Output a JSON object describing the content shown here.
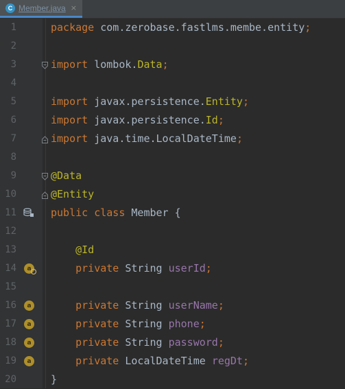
{
  "tab": {
    "icon_letter": "C",
    "title": "Member.java",
    "close_glyph": "×"
  },
  "editor": {
    "lines": [
      {
        "n": "1",
        "tokens": [
          {
            "t": "package ",
            "c": "kw"
          },
          {
            "t": "com.zerobase.fastlms.membe.entity",
            "c": ""
          },
          {
            "t": ";",
            "c": "kw"
          }
        ]
      },
      {
        "n": "2",
        "tokens": []
      },
      {
        "n": "3",
        "fold": "start",
        "tokens": [
          {
            "t": "import ",
            "c": "kw"
          },
          {
            "t": "lombok.",
            "c": ""
          },
          {
            "t": "Data",
            "c": "ann"
          },
          {
            "t": ";",
            "c": "kw"
          }
        ]
      },
      {
        "n": "4",
        "tokens": []
      },
      {
        "n": "5",
        "tokens": [
          {
            "t": "import ",
            "c": "kw"
          },
          {
            "t": "javax.persistence.",
            "c": ""
          },
          {
            "t": "Entity",
            "c": "ann"
          },
          {
            "t": ";",
            "c": "kw"
          }
        ]
      },
      {
        "n": "6",
        "tokens": [
          {
            "t": "import ",
            "c": "kw"
          },
          {
            "t": "javax.persistence.",
            "c": ""
          },
          {
            "t": "Id",
            "c": "ann"
          },
          {
            "t": ";",
            "c": "kw"
          }
        ]
      },
      {
        "n": "7",
        "fold": "end",
        "tokens": [
          {
            "t": "import ",
            "c": "kw"
          },
          {
            "t": "java.time.LocalDateTime",
            "c": ""
          },
          {
            "t": ";",
            "c": "kw"
          }
        ]
      },
      {
        "n": "8",
        "tokens": []
      },
      {
        "n": "9",
        "fold": "start",
        "tokens": [
          {
            "t": "@Data",
            "c": "ann"
          }
        ]
      },
      {
        "n": "10",
        "fold": "end",
        "tokens": [
          {
            "t": "@Entity",
            "c": "ann"
          }
        ]
      },
      {
        "n": "11",
        "gutter_icon": "database-entity-icon",
        "tokens": [
          {
            "t": "public class ",
            "c": "kw"
          },
          {
            "t": "Member {",
            "c": ""
          }
        ]
      },
      {
        "n": "12",
        "tokens": []
      },
      {
        "n": "13",
        "tokens": [
          {
            "t": "    ",
            "c": ""
          },
          {
            "t": "@Id",
            "c": "ann"
          }
        ]
      },
      {
        "n": "14",
        "gutter_icon": "field-primary-key-icon",
        "tokens": [
          {
            "t": "    ",
            "c": ""
          },
          {
            "t": "private ",
            "c": "kw"
          },
          {
            "t": "String ",
            "c": ""
          },
          {
            "t": "userId",
            "c": "field"
          },
          {
            "t": ";",
            "c": "kw"
          }
        ]
      },
      {
        "n": "15",
        "tokens": []
      },
      {
        "n": "16",
        "gutter_icon": "field-attribute-icon",
        "tokens": [
          {
            "t": "    ",
            "c": ""
          },
          {
            "t": "private ",
            "c": "kw"
          },
          {
            "t": "String ",
            "c": ""
          },
          {
            "t": "userName",
            "c": "field"
          },
          {
            "t": ";",
            "c": "kw"
          }
        ]
      },
      {
        "n": "17",
        "gutter_icon": "field-attribute-icon",
        "tokens": [
          {
            "t": "    ",
            "c": ""
          },
          {
            "t": "private ",
            "c": "kw"
          },
          {
            "t": "String ",
            "c": ""
          },
          {
            "t": "phone",
            "c": "field"
          },
          {
            "t": ";",
            "c": "kw"
          }
        ]
      },
      {
        "n": "18",
        "gutter_icon": "field-attribute-icon",
        "tokens": [
          {
            "t": "    ",
            "c": ""
          },
          {
            "t": "private ",
            "c": "kw"
          },
          {
            "t": "String ",
            "c": ""
          },
          {
            "t": "password",
            "c": "field"
          },
          {
            "t": ";",
            "c": "kw"
          }
        ]
      },
      {
        "n": "19",
        "gutter_icon": "field-attribute-icon",
        "tokens": [
          {
            "t": "    ",
            "c": ""
          },
          {
            "t": "private ",
            "c": "kw"
          },
          {
            "t": "LocalDateTime ",
            "c": ""
          },
          {
            "t": "regDt",
            "c": "field"
          },
          {
            "t": ";",
            "c": "kw"
          }
        ]
      },
      {
        "n": "20",
        "tokens": [
          {
            "t": "}",
            "c": ""
          }
        ]
      }
    ],
    "gutter_icon_letter": "a"
  },
  "colors": {
    "background": "#2b2b2b",
    "gutter": "#313335",
    "keyword": "#cc7832",
    "annotation": "#bbb529",
    "field": "#9876aa",
    "text": "#a9b7c6",
    "line_number": "#606366"
  }
}
